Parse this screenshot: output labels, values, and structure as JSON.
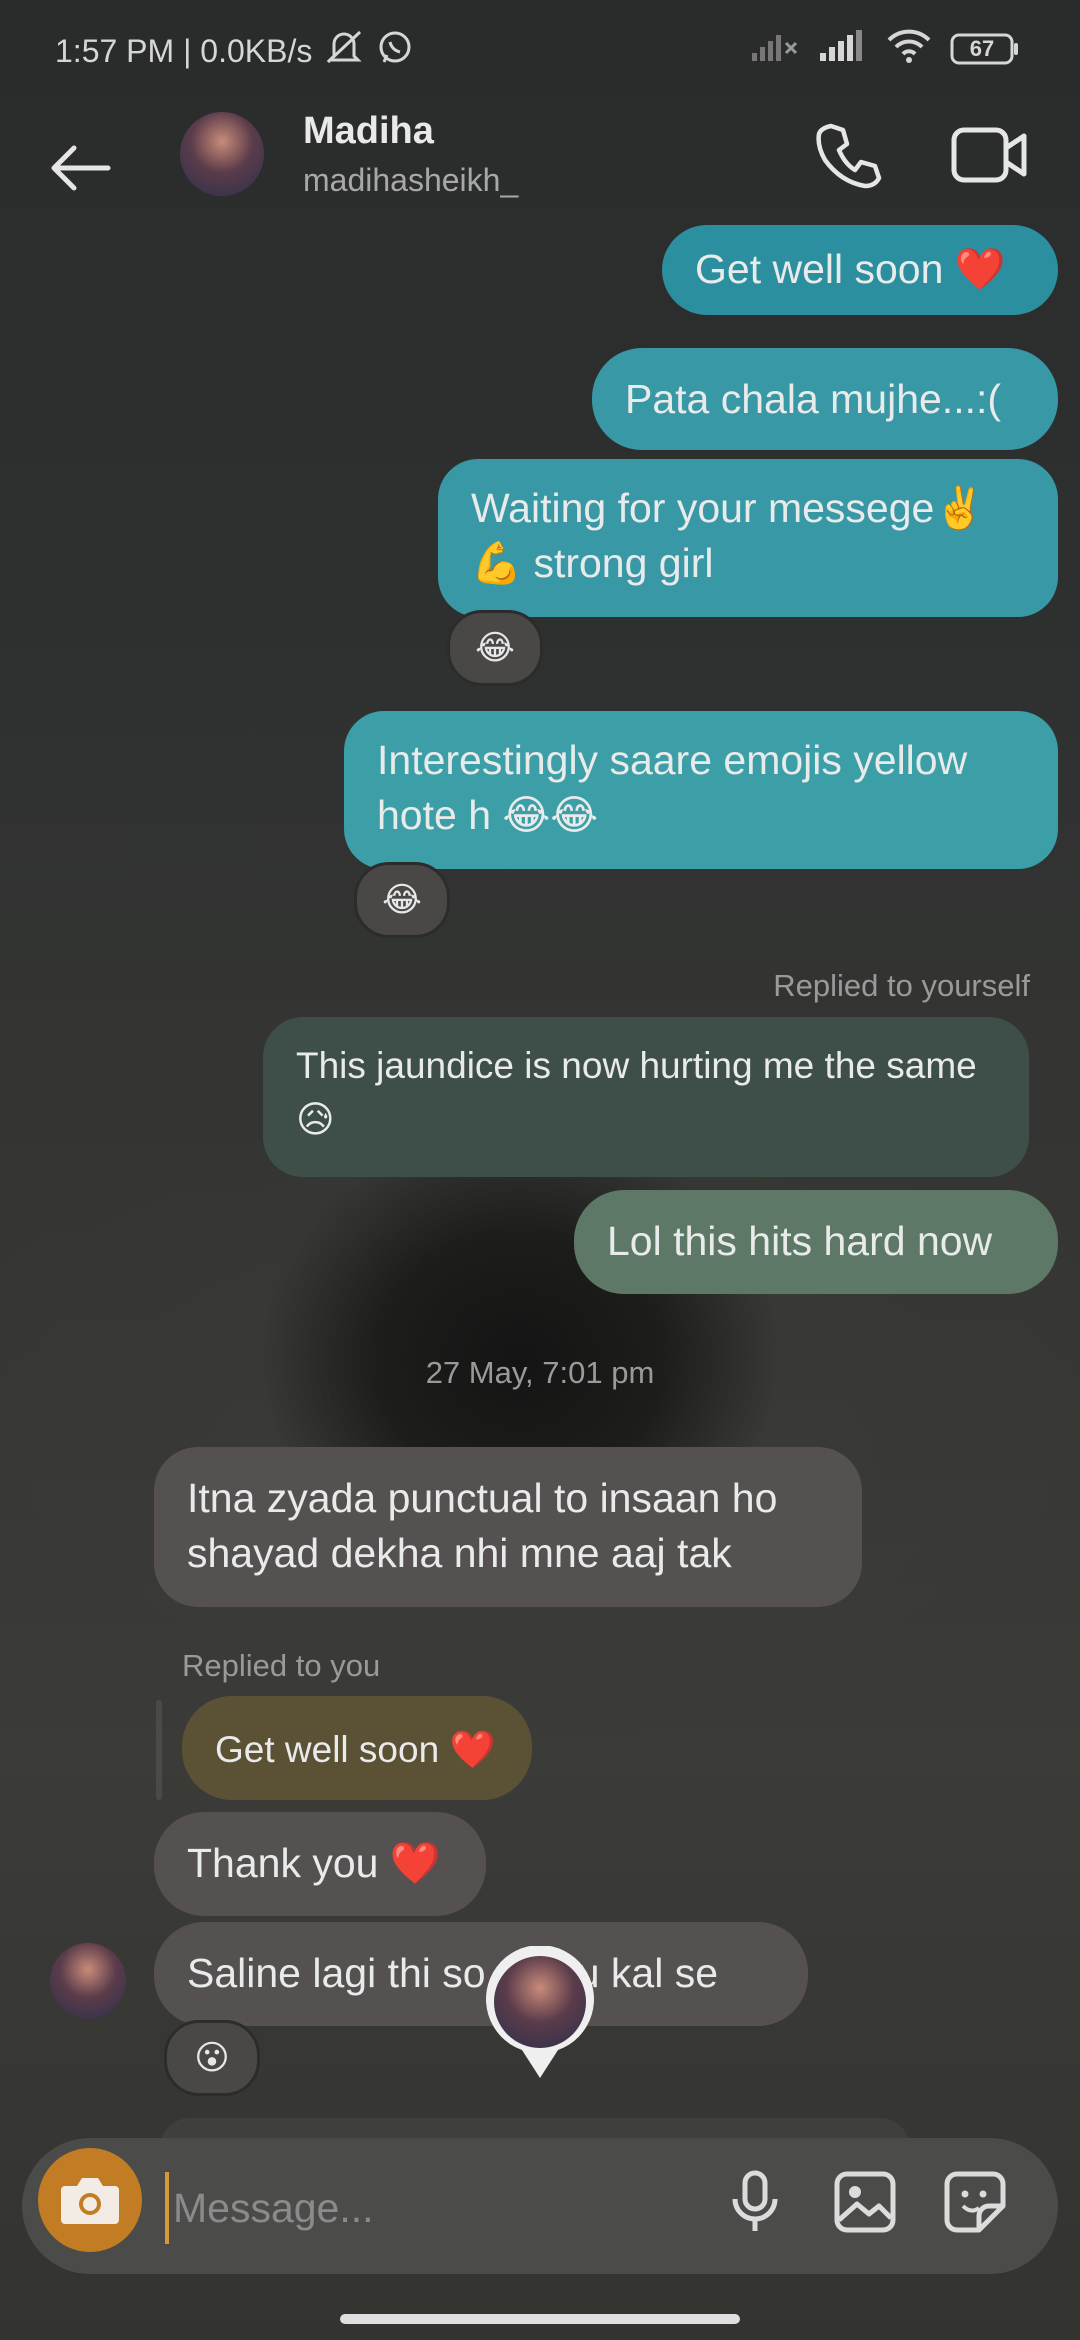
{
  "status_bar": {
    "time_speed": "1:57 PM | 0.0KB/s",
    "battery": "67"
  },
  "header": {
    "name": "Madiha",
    "username": "madihasheikh_"
  },
  "messages": {
    "m1": "Get well soon ❤️",
    "m2": "Pata chala mujhe...:(",
    "m3_line1": "Waiting for your messege✌️",
    "m3_line2": "💪 strong girl",
    "m3_reaction": "😂",
    "m4_line1": "Interestingly saare emojis yellow",
    "m4_line2": "hote h 😂😂",
    "m4_reaction": "😂",
    "reply_label_self": "Replied to yourself",
    "m5_line1": "This jaundice is now hurting me the same",
    "m5_line2": "😥",
    "m6": "Lol this hits hard now",
    "date_sep": "27 May, 7:01 pm",
    "m7_line1": "Itna zyada punctual to insaan ho",
    "m7_line2": "shayad dekha nhi mne aaj tak",
    "reply_label_you": "Replied to you",
    "m8_quoted": "Get well soon ❤️",
    "m9": "Thank you ❤️",
    "m10": "Saline lagi thi so rhi hu kal se",
    "m10_reaction": "😮"
  },
  "composer": {
    "placeholder": "Message..."
  },
  "colors": {
    "outgoing": "#2b8f9f",
    "incoming": "#545150",
    "camera_button": "#c27d24"
  }
}
